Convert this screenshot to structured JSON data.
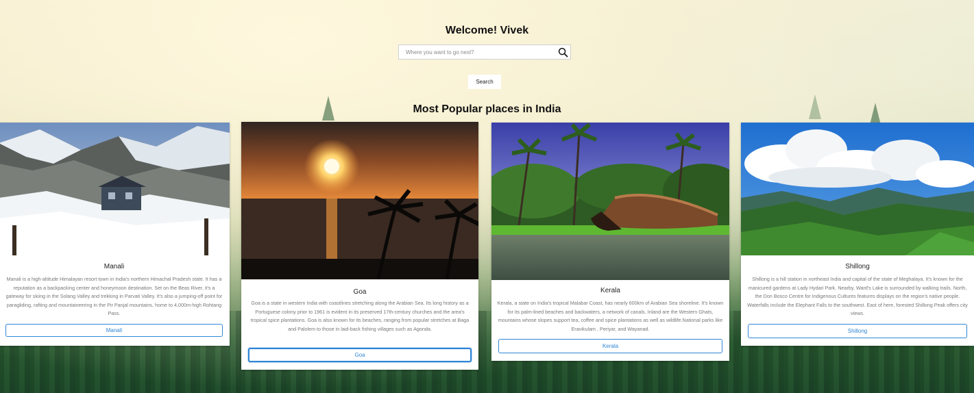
{
  "header": {
    "welcome": "Welcome! Vivek"
  },
  "search": {
    "placeholder": "Where you want to go next?",
    "value": "",
    "button_label": "Search"
  },
  "section": {
    "title": "Most Popular places in India"
  },
  "places": [
    {
      "name": "Manali",
      "description": "Manali is a high-altitude Himalayan resort town in India's northern Himachal Pradesh state. It has a reputation as a backpacking center and honeymoon destination. Set on the Beas River, it's a gateway for skiing in the Solang Valley and trekking in Parvati Valley. It's also a jumping-off point for paragliding, rafting and mountaineering in the Pir Panjal mountains, home to 4,000m-high Rohtang Pass.",
      "button_label": "Manali"
    },
    {
      "name": "Goa",
      "description": "Goa is a state in western India with coastlines stretching along the Arabian Sea. Its long history as a Portuguese colony prior to 1961 is evident in its preserved 17th-century churches and the area's tropical spice plantations. Goa is also known for its beaches, ranging from popular stretches at Baga and Palolem to those in laid-back fishing villages such as Agonda.",
      "button_label": "Goa"
    },
    {
      "name": "Kerala",
      "description": "Kerala, a state on India's tropical Malabar Coast, has nearly 600km of Arabian Sea shoreline. It's known for its palm-lined beaches and backwaters, a network of canals. Inland are the Western Ghats, mountains whose slopes support tea, coffee and spice plantations as well as wildlife.National parks like Eravikulam , Periyar, and Wayanad.",
      "button_label": "Kerala"
    },
    {
      "name": "Shillong",
      "description": "Shillong is a hill station in northeast India and capital of the state of Meghalaya. It's known for the manicured gardens at Lady Hydari Park. Nearby, Ward's Lake is surrounded by walking trails. North, the Don Bosco Centre for Indigenous Cultures features displays on the region's native people. Waterfalls include the Elephant Falls to the southwest. East of here, forested Shillong Peak offers city views.",
      "button_label": "Shillong"
    }
  ],
  "icons": {
    "search": "search-icon"
  },
  "colors": {
    "accent": "#2f86d6"
  }
}
